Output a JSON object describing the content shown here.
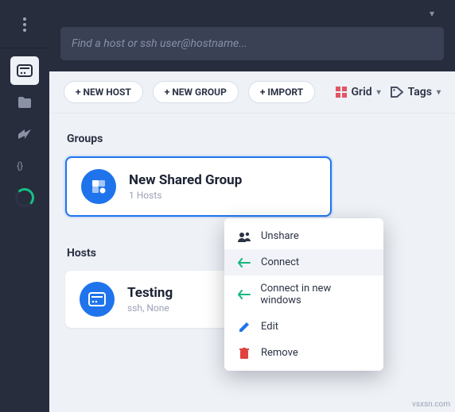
{
  "sidebar": {
    "items": [
      "menu",
      "hosts",
      "files",
      "snippets",
      "keys",
      "sync"
    ]
  },
  "search": {
    "placeholder": "Find a host or ssh user@hostname..."
  },
  "toolbar": {
    "new_host": "+ NEW HOST",
    "new_group": "+ NEW GROUP",
    "import": "+ IMPORT",
    "view_label": "Grid",
    "tags_label": "Tags"
  },
  "sections": {
    "groups": "Groups",
    "hosts": "Hosts"
  },
  "group": {
    "name": "New Shared Group",
    "subtitle": "1 Hosts"
  },
  "host": {
    "name": "Testing",
    "subtitle": "ssh, None"
  },
  "ctx_menu": {
    "items": [
      {
        "label": "Unshare",
        "icon": "unshare"
      },
      {
        "label": "Connect",
        "icon": "connect"
      },
      {
        "label": "Connect in new windows",
        "icon": "connect"
      },
      {
        "label": "Edit",
        "icon": "edit"
      },
      {
        "label": "Remove",
        "icon": "remove"
      }
    ],
    "hover_index": 1
  },
  "footer": "vsxsn.com"
}
